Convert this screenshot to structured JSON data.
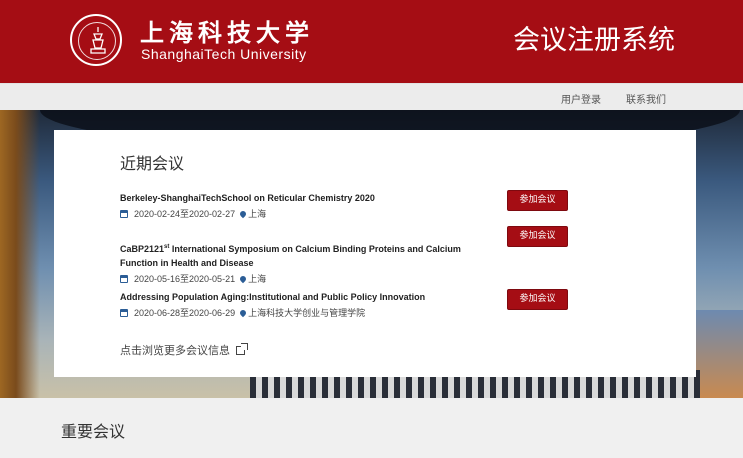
{
  "header": {
    "logo_cn": "上海科技大学",
    "logo_en": "ShanghaiTech University",
    "system_title": "会议注册系统",
    "brand_color": "#a50d14"
  },
  "nav": {
    "login": "用户登录",
    "contact": "联系我们"
  },
  "recent": {
    "title": "近期会议",
    "conferences": [
      {
        "name": "Berkeley-ShanghaiTechSchool on Reticular Chemistry 2020",
        "dates": "2020-02-24至2020-02-27",
        "location": "上海",
        "button": "参加会议"
      },
      {
        "name_main": "CaBP2121",
        "name_sup": "st",
        "name_rest": " International Symposium on Calcium Binding Proteins and Calcium Function in Health and Disease",
        "dates": "2020-05-16至2020-05-21",
        "location": "上海",
        "button": "参加会议"
      },
      {
        "name": "Addressing Population Aging:Institutional and Public Policy Innovation",
        "dates": "2020-06-28至2020-06-29",
        "location": "上海科技大学创业与管理学院",
        "button": "参加会议"
      }
    ],
    "more_link": "点击浏览更多会议信息"
  },
  "important": {
    "title": "重要会议"
  }
}
